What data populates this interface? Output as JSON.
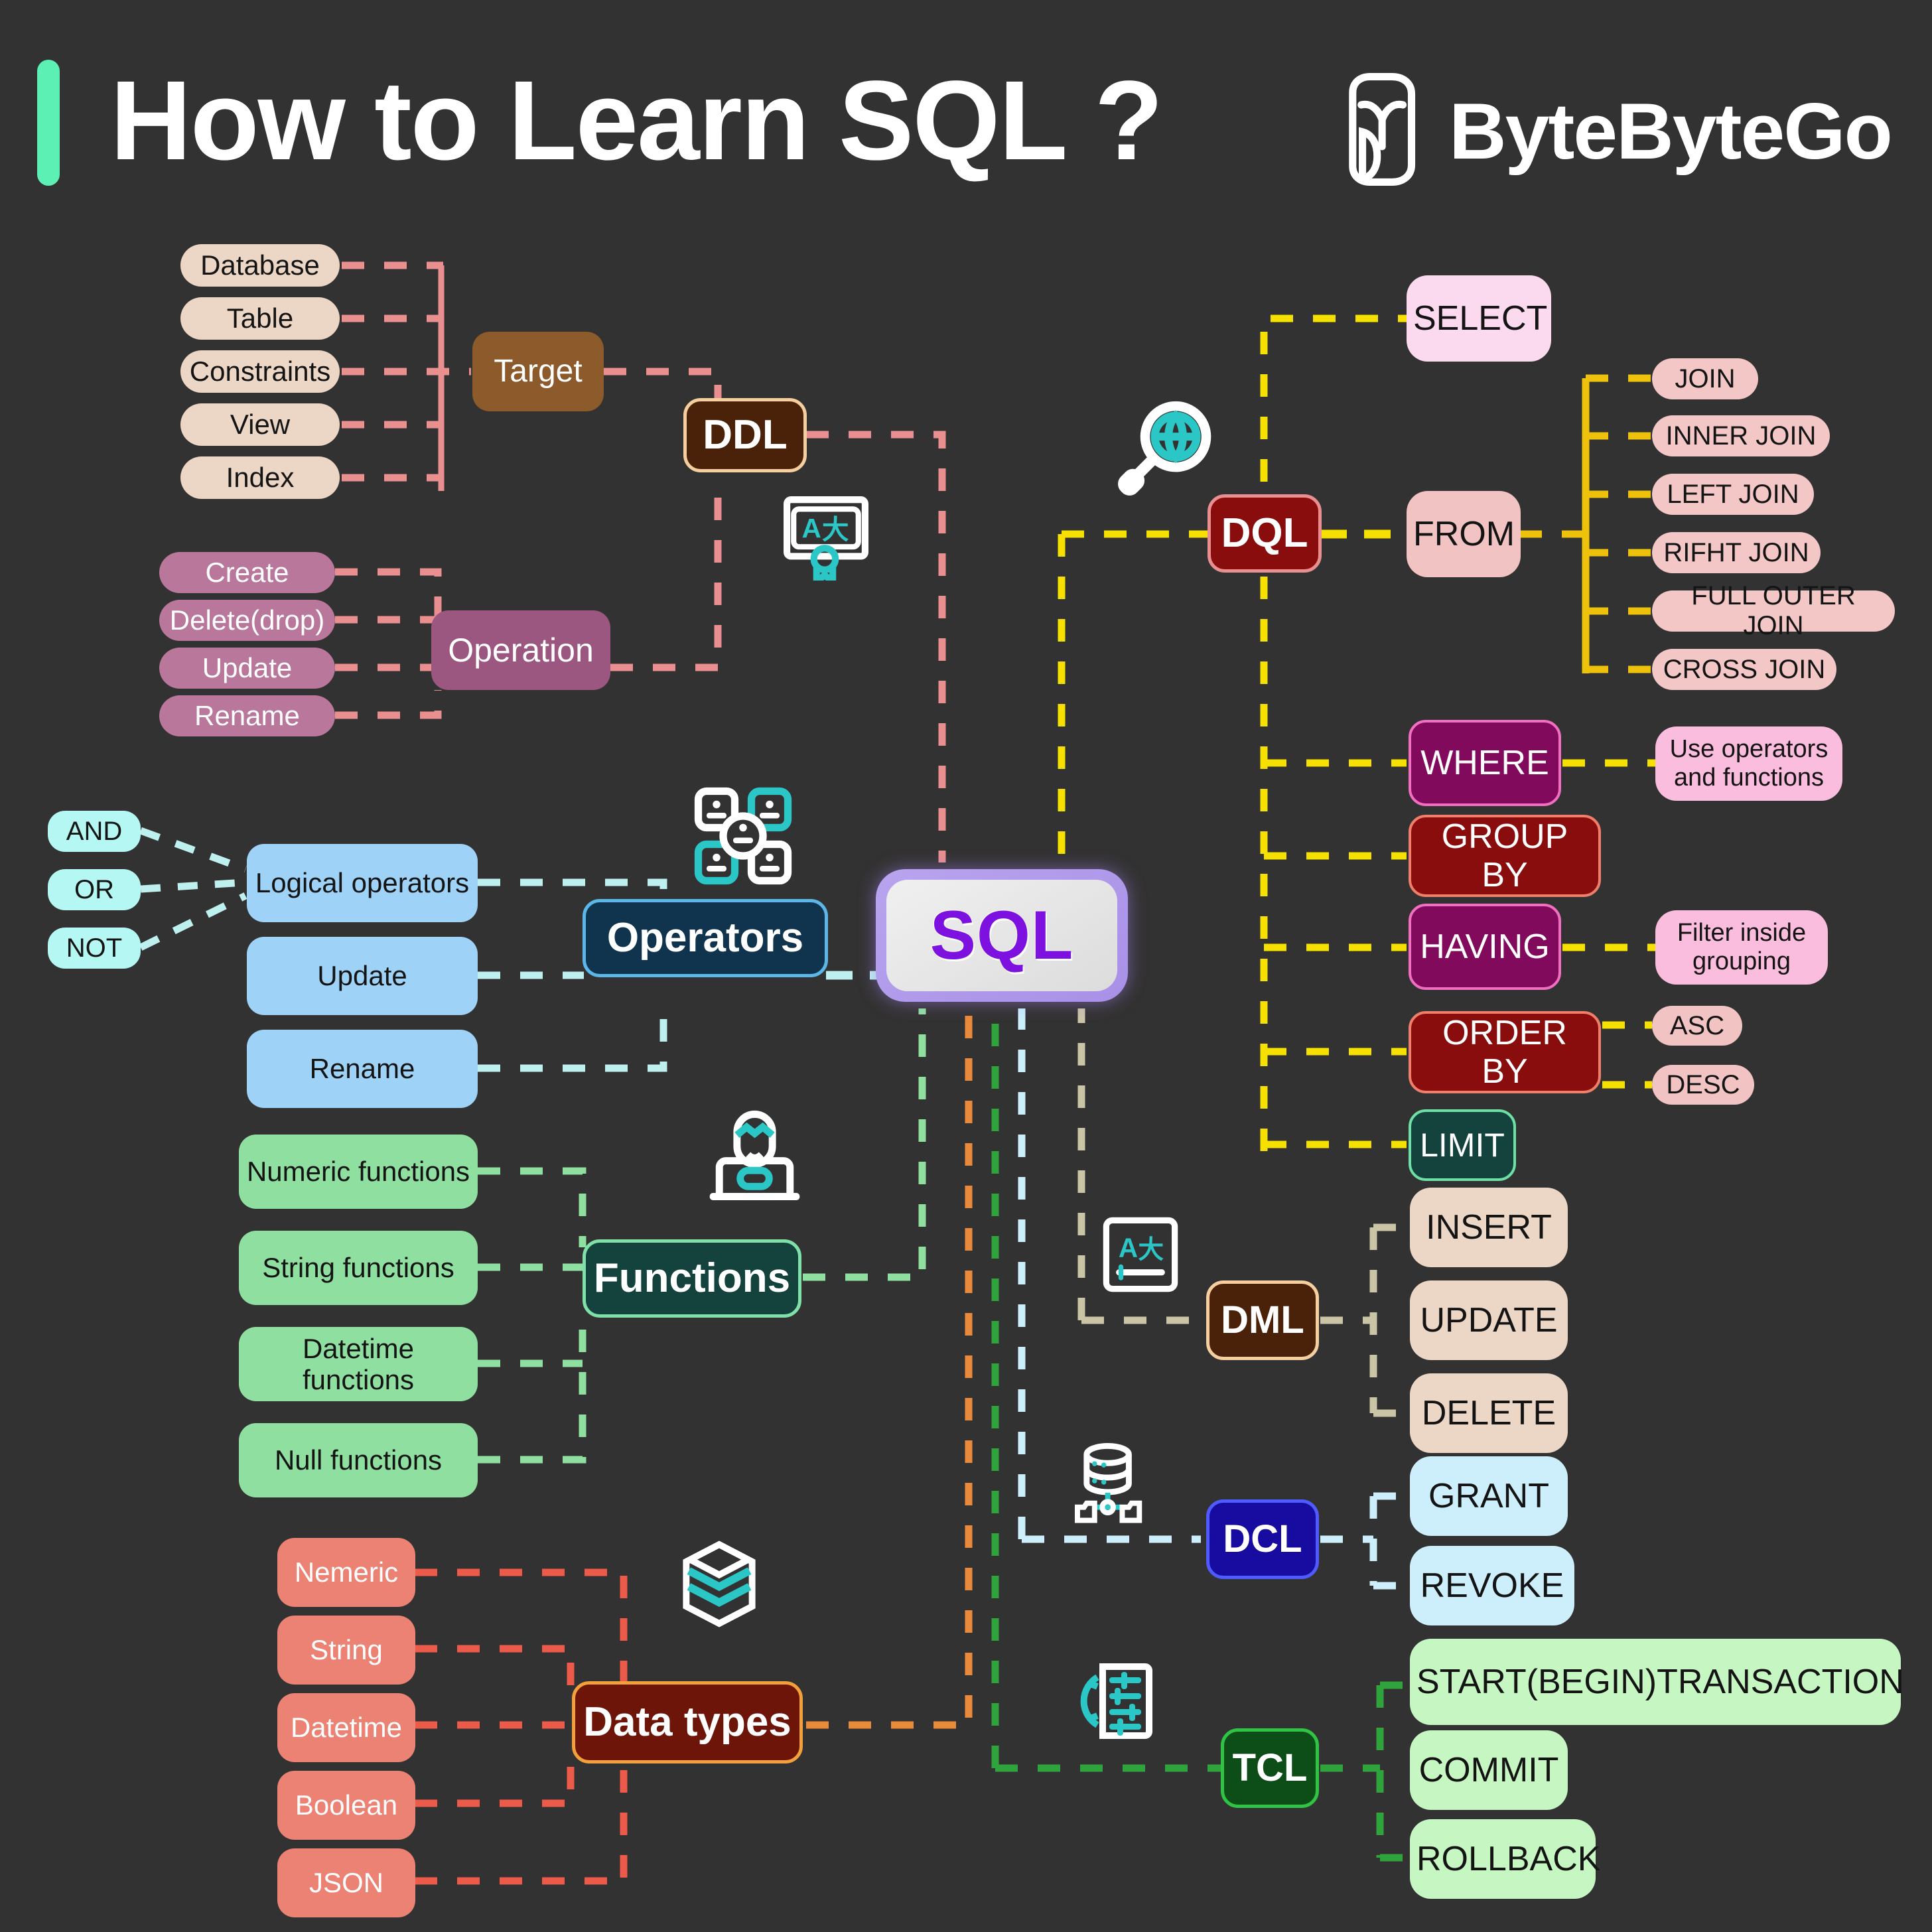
{
  "header": {
    "title": "How to Learn SQL ?",
    "brand": "ByteByteGo",
    "logo_icon": "bytebytego-logo-icon",
    "accent_color": "#5cf0b5"
  },
  "center": {
    "label": "SQL"
  },
  "ddl": {
    "hub_label": "DDL",
    "icon": "certificate-board-icon",
    "target": {
      "label": "Target",
      "items": [
        "Database",
        "Table",
        "Constraints",
        "View",
        "Index"
      ]
    },
    "operation": {
      "label": "Operation",
      "items": [
        "Create",
        "Delete(drop)",
        "Update",
        "Rename"
      ]
    }
  },
  "dql": {
    "hub_label": "DQL",
    "icon": "globe-search-icon",
    "clauses": [
      "SELECT",
      "FROM",
      "WHERE",
      "GROUP BY",
      "HAVING",
      "ORDER BY",
      "LIMIT"
    ],
    "joins": [
      "JOIN",
      "INNER JOIN",
      "LEFT JOIN",
      "RIFHT JOIN",
      "FULL OUTER JOIN",
      "CROSS JOIN"
    ],
    "where_note": "Use operators and functions",
    "having_note": "Filter inside grouping",
    "order_options": [
      "ASC",
      "DESC"
    ]
  },
  "operators": {
    "hub_label": "Operators",
    "icon": "operator-grid-icon",
    "items": [
      "Logical operators",
      "Update",
      "Rename"
    ],
    "logical": [
      "AND",
      "OR",
      "NOT"
    ]
  },
  "functions": {
    "hub_label": "Functions",
    "icon": "person-laptop-icon",
    "items": [
      "Numeric functions",
      "String functions",
      "Datetime functions",
      "Null functions"
    ]
  },
  "data_types": {
    "hub_label": "Data types",
    "icon": "layers-stack-icon",
    "items": [
      "Nemeric",
      "String",
      "Datetime",
      "Boolean",
      "JSON"
    ]
  },
  "dml": {
    "hub_label": "DML",
    "icon": "certificate-board-icon",
    "items": [
      "INSERT",
      "UPDATE",
      "DELETE"
    ]
  },
  "dcl": {
    "hub_label": "DCL",
    "icon": "database-share-icon",
    "items": [
      "GRANT",
      "REVOKE"
    ]
  },
  "tcl": {
    "hub_label": "TCL",
    "icon": "settings-sliders-icon",
    "items": [
      "START(BEGIN)TRANSACTION",
      "COMMIT",
      "ROLLBACK"
    ]
  },
  "colors": {
    "background": "#333232",
    "ddl_wire": "#e98f8f",
    "dql_wire": "#f5e000",
    "join_wire": "#eec20a",
    "operators_wire": "#bdf0ee",
    "functions_wire": "#8fe0a0",
    "datatypes_wire": "#ec5b4a",
    "dml_wire": "#cbc5a8",
    "dcl_wire": "#cdeffc",
    "tcl_wire": "#2fa33c",
    "sql_text": "#7d12e0"
  }
}
